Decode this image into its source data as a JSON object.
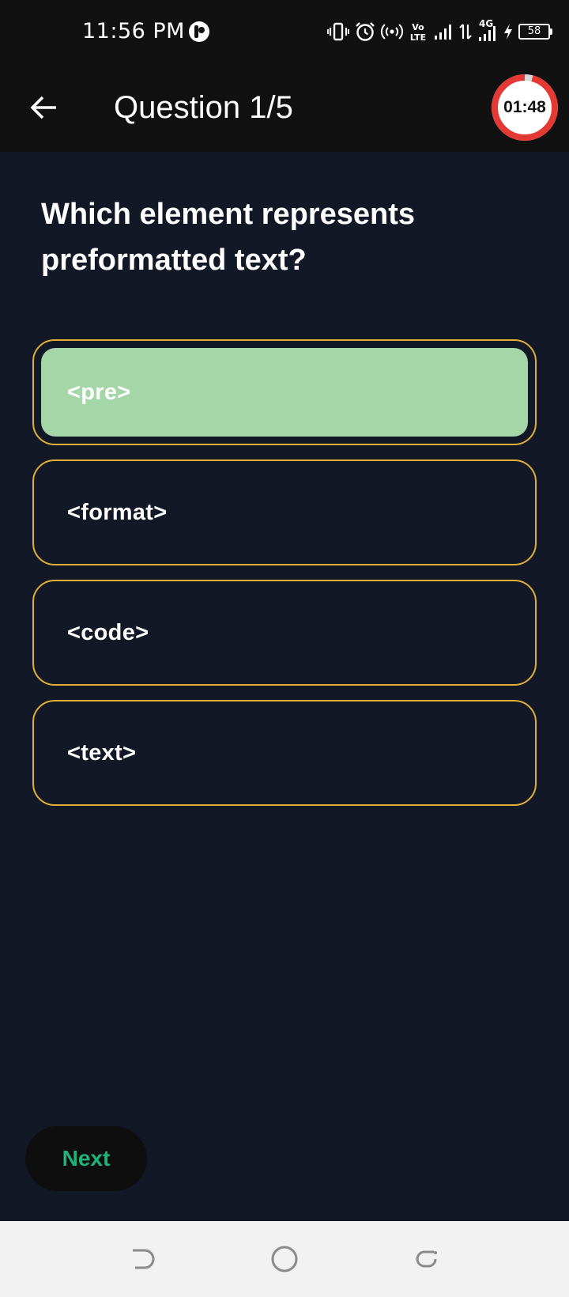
{
  "status_bar": {
    "time": "11:56 PM",
    "network_label": "4G",
    "volte_label": "Vo LTE",
    "battery_level": "58"
  },
  "app_bar": {
    "title": "Question 1/5",
    "timer": "01:48",
    "timer_remaining_fraction": 0.96
  },
  "question": {
    "text": "Which element represents preformatted text?"
  },
  "options": [
    {
      "label": "<pre>",
      "selected": true
    },
    {
      "label": "<format>",
      "selected": false
    },
    {
      "label": "<code>",
      "selected": false
    },
    {
      "label": "<text>",
      "selected": false
    }
  ],
  "next_button": {
    "label": "Next"
  },
  "colors": {
    "background": "#131827",
    "bar": "#111111",
    "option_border": "#e0b03a",
    "selected_fill": "#a5d6a7",
    "next_text": "#1db47c",
    "timer_ring": "#e53935"
  }
}
